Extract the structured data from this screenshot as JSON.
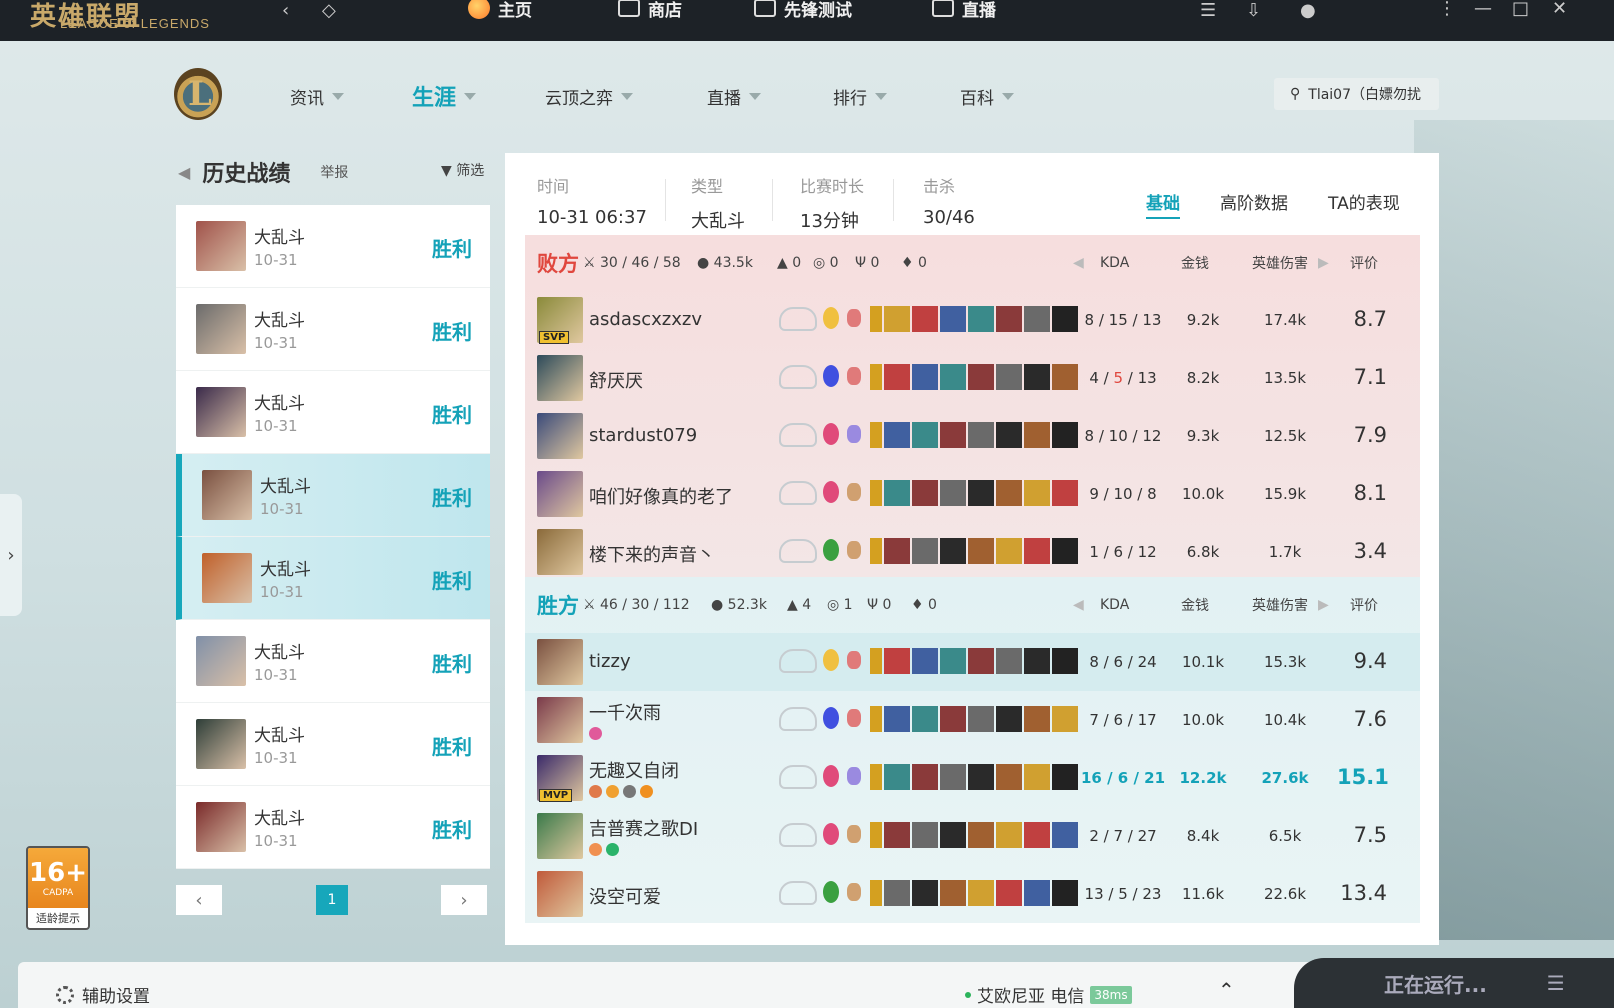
{
  "topbar": {
    "logo": "英雄联盟",
    "logo_sub": "LEAGUE of LEGENDS",
    "nav": [
      "主页",
      "商店",
      "先锋测试",
      "直播"
    ]
  },
  "nav": {
    "items": [
      "资讯",
      "生涯",
      "云顶之弈",
      "直播",
      "排行",
      "百科"
    ],
    "active": "生涯",
    "search": "Tlai07（白嫖勿扰"
  },
  "history": {
    "title": "历史战绩",
    "report": "举报",
    "filter": "筛选",
    "matches": [
      {
        "mode": "大乱斗",
        "date": "10-31",
        "result": "胜利",
        "color": "#a0524a"
      },
      {
        "mode": "大乱斗",
        "date": "10-31",
        "result": "胜利",
        "color": "#6b6b6b"
      },
      {
        "mode": "大乱斗",
        "date": "10-31",
        "result": "胜利",
        "color": "#3a2a4a"
      },
      {
        "mode": "大乱斗",
        "date": "10-31",
        "result": "胜利",
        "color": "#7a5040",
        "selected": true
      },
      {
        "mode": "大乱斗",
        "date": "10-31",
        "result": "胜利",
        "color": "#c0602a",
        "selected": true
      },
      {
        "mode": "大乱斗",
        "date": "10-31",
        "result": "胜利",
        "color": "#8090a8"
      },
      {
        "mode": "大乱斗",
        "date": "10-31",
        "result": "胜利",
        "color": "#2e3e38"
      },
      {
        "mode": "大乱斗",
        "date": "10-31",
        "result": "胜利",
        "color": "#7a2a2a"
      }
    ],
    "page": "1"
  },
  "summary": {
    "time_label": "时间",
    "time": "10-31 06:37",
    "type_label": "类型",
    "type": "大乱斗",
    "duration_label": "比赛时长",
    "duration": "13分钟",
    "kills_label": "击杀",
    "kills": "30/46"
  },
  "tabs": [
    "基础",
    "高阶数据",
    "TA的表现"
  ],
  "columns": {
    "kda": "KDA",
    "gold": "金钱",
    "damage": "英雄伤害",
    "rating": "评价"
  },
  "teams": [
    {
      "name": "败方",
      "color": "#e0473e",
      "kda": "30 / 46 / 58",
      "gold": "43.5k",
      "towers": "0",
      "inhib": "0",
      "baron": "0",
      "dragon": "0",
      "players": [
        {
          "name": "asdascxzxzv",
          "badge": "SVP",
          "kda": "8 / 15 / 13",
          "gold": "9.2k",
          "dmg": "17.4k",
          "score": "8.7",
          "c": "#8a8a3a"
        },
        {
          "name": "舒厌厌",
          "kda_parts": [
            "4 / ",
            "5",
            " / 13"
          ],
          "kda": "4 / 5 / 13",
          "gold": "8.2k",
          "dmg": "13.5k",
          "score": "7.1",
          "c": "#2c4a5a",
          "death_red": true
        },
        {
          "name": "stardust079",
          "kda": "8 / 10 / 12",
          "gold": "9.3k",
          "dmg": "12.5k",
          "score": "7.9",
          "c": "#3a4a7a"
        },
        {
          "name": "咱们好像真的老了",
          "kda": "9 / 10 / 8",
          "gold": "10.0k",
          "dmg": "15.9k",
          "score": "8.1",
          "c": "#6a4a8a"
        },
        {
          "name": "楼下来的声音丶",
          "kda": "1 / 6 / 12",
          "gold": "6.8k",
          "dmg": "1.7k",
          "score": "3.4",
          "c": "#8a6a3a"
        }
      ]
    },
    {
      "name": "胜方",
      "color": "#14a2b8",
      "kda": "46 / 30 / 112",
      "gold": "52.3k",
      "towers": "4",
      "inhib": "1",
      "baron": "0",
      "dragon": "0",
      "players": [
        {
          "name": "tizzy",
          "kda": "8 / 6 / 24",
          "gold": "10.1k",
          "dmg": "15.3k",
          "score": "9.4",
          "c": "#7a5040",
          "me": true
        },
        {
          "name": "一千次雨",
          "kda": "7 / 6 / 17",
          "gold": "10.0k",
          "dmg": "10.4k",
          "score": "7.6",
          "c": "#7a3a4a",
          "tags": [
            "#e05a9a"
          ]
        },
        {
          "name": "无趣又自闭",
          "badge": "MVP",
          "kda": "16 / 6 / 21",
          "gold": "12.2k",
          "dmg": "27.6k",
          "score": "15.1",
          "c": "#3a2a6a",
          "mvp": true,
          "tags": [
            "#e07a4a",
            "#f0a030",
            "#777",
            "#f09020"
          ]
        },
        {
          "name": "吉普赛之歌DI",
          "kda": "2 / 7 / 27",
          "gold": "8.4k",
          "dmg": "6.5k",
          "score": "7.5",
          "c": "#3a7a4a",
          "tags": [
            "#f09050",
            "#2ab36a"
          ]
        },
        {
          "name": "没空可爱",
          "kda": "13 / 5 / 23",
          "gold": "11.6k",
          "dmg": "22.6k",
          "score": "13.4",
          "c": "#c05a3a"
        }
      ]
    }
  ],
  "age": {
    "rating": "16+",
    "org": "CADPA",
    "note": "适龄提示"
  },
  "bottom": {
    "assist": "辅助设置",
    "server": "艾欧尼亚 电信",
    "ping": "38ms",
    "running": "正在运行..."
  }
}
